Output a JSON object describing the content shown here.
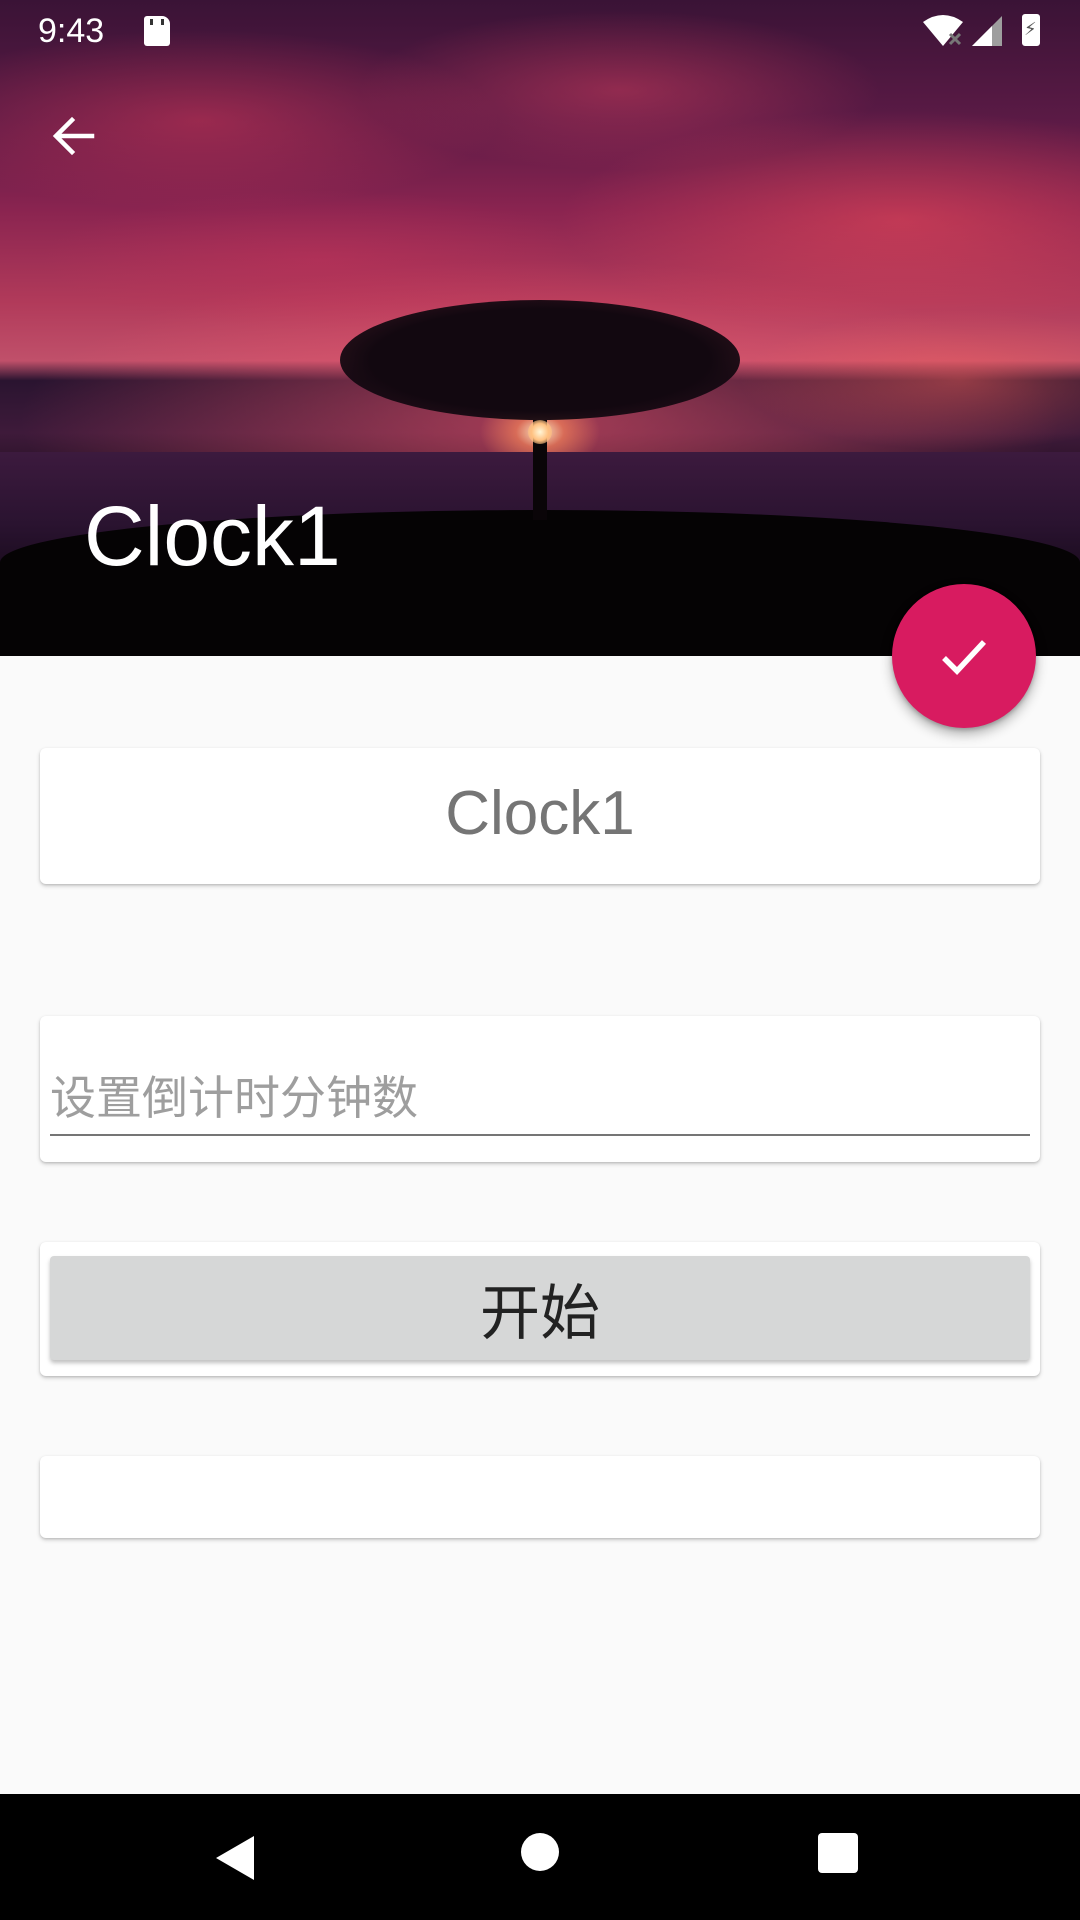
{
  "status_bar": {
    "time": "9:43",
    "icons": [
      "sd-card-icon",
      "wifi-icon",
      "signal-icon",
      "battery-charging-icon"
    ]
  },
  "toolbar": {
    "back_icon": "arrow-back-icon",
    "title": "Clock1"
  },
  "fab": {
    "icon": "check-icon",
    "color": "#d81b60"
  },
  "form": {
    "clock_name": "Clock1",
    "minutes_input": {
      "value": "",
      "placeholder": "设置倒计时分钟数"
    },
    "start_button_label": "开始",
    "result_text": ""
  },
  "nav_bar": {
    "icons": [
      "nav-back-icon",
      "nav-home-icon",
      "nav-recents-icon"
    ]
  }
}
